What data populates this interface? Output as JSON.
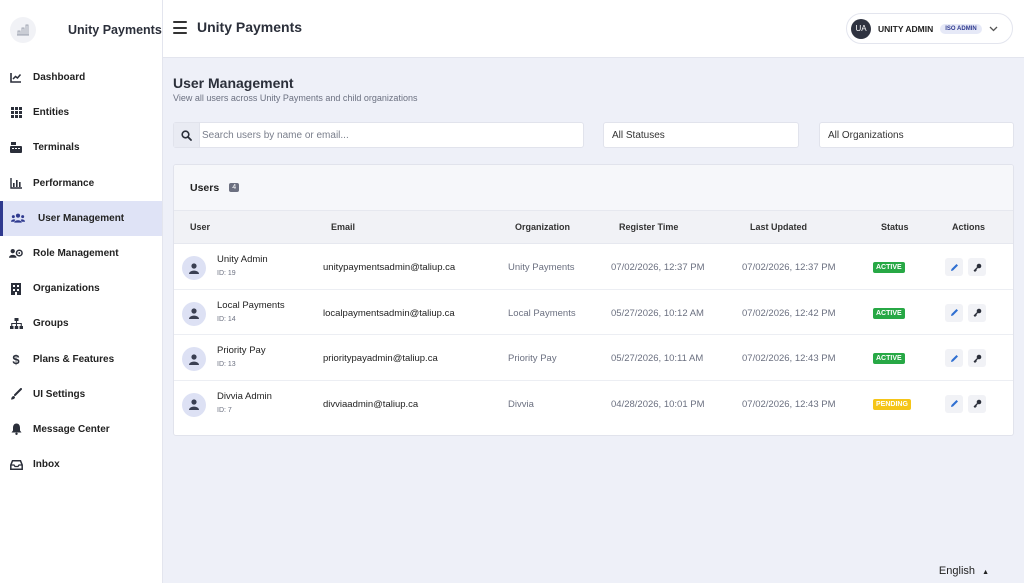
{
  "brand": {
    "name": "Unity Payments",
    "logo_icon": "chart-logo-icon"
  },
  "sidebar": {
    "items": [
      {
        "label": "Dashboard",
        "icon": "line-chart-icon"
      },
      {
        "label": "Entities",
        "icon": "grid-icon"
      },
      {
        "label": "Terminals",
        "icon": "cash-register-icon"
      },
      {
        "label": "Performance",
        "icon": "bar-chart-icon"
      },
      {
        "label": "User Management",
        "icon": "users-icon",
        "active": true
      },
      {
        "label": "Role Management",
        "icon": "roles-icon"
      },
      {
        "label": "Organizations",
        "icon": "building-icon"
      },
      {
        "label": "Groups",
        "icon": "sitemap-icon"
      },
      {
        "label": "Plans & Features",
        "icon": "dollar-icon"
      },
      {
        "label": "UI Settings",
        "icon": "brush-icon"
      },
      {
        "label": "Message Center",
        "icon": "bell-icon"
      },
      {
        "label": "Inbox",
        "icon": "inbox-icon"
      }
    ]
  },
  "header": {
    "title": "Unity Payments",
    "user": {
      "initials": "UA",
      "name": "UNITY ADMIN",
      "role": "ISO ADMIN"
    }
  },
  "page": {
    "title": "User Management",
    "subtitle": "View all users across Unity Payments and child organizations"
  },
  "filters": {
    "search_placeholder": "Search users by name or email...",
    "status_value": "All Statuses",
    "org_value": "All Organizations"
  },
  "table": {
    "title": "Users",
    "count": "4",
    "columns": [
      "User",
      "Email",
      "Organization",
      "Register Time",
      "Last Updated",
      "Status",
      "Actions"
    ],
    "rows": [
      {
        "name": "Unity Admin",
        "id": "ID: 19",
        "email": "unitypaymentsadmin@taliup.ca",
        "org": "Unity Payments",
        "registered": "07/02/2026, 12:37 PM",
        "updated": "07/02/2026, 12:37 PM",
        "status": "ACTIVE"
      },
      {
        "name": "Local Payments",
        "id": "ID: 14",
        "email": "localpaymentsadmin@taliup.ca",
        "org": "Local Payments",
        "registered": "05/27/2026, 10:12 AM",
        "updated": "07/02/2026, 12:42 PM",
        "status": "ACTIVE"
      },
      {
        "name": "Priority Pay",
        "id": "ID: 13",
        "email": "prioritypayadmin@taliup.ca",
        "org": "Priority Pay",
        "registered": "05/27/2026, 10:11 AM",
        "updated": "07/02/2026, 12:43 PM",
        "status": "ACTIVE"
      },
      {
        "name": "Divvia Admin",
        "id": "ID: 7",
        "email": "divviaadmin@taliup.ca",
        "org": "Divvia",
        "registered": "04/28/2026, 10:01 PM",
        "updated": "07/02/2026, 12:43 PM",
        "status": "PENDING"
      }
    ]
  },
  "footer": {
    "language": "English"
  },
  "colors": {
    "accent": "#2f3a8f",
    "active": "#27a845",
    "pending": "#f5c518"
  }
}
